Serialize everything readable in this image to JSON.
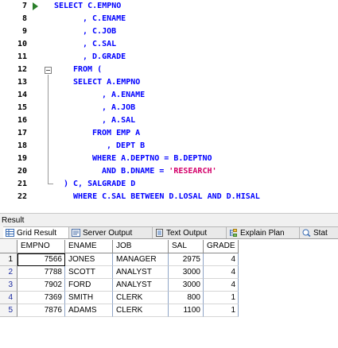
{
  "editor": {
    "lines": [
      {
        "num": "7",
        "indent": 0,
        "code": "SELECT C.EMPNO"
      },
      {
        "num": "8",
        "indent": 6,
        "code": ", C.ENAME"
      },
      {
        "num": "9",
        "indent": 6,
        "code": ", C.JOB"
      },
      {
        "num": "10",
        "indent": 6,
        "code": ", C.SAL"
      },
      {
        "num": "11",
        "indent": 6,
        "code": ", D.GRADE"
      },
      {
        "num": "12",
        "indent": 4,
        "code": "FROM ("
      },
      {
        "num": "13",
        "indent": 4,
        "code": "SELECT A.EMPNO"
      },
      {
        "num": "14",
        "indent": 10,
        "code": ", A.ENAME"
      },
      {
        "num": "15",
        "indent": 10,
        "code": ", A.JOB"
      },
      {
        "num": "16",
        "indent": 10,
        "code": ", A.SAL"
      },
      {
        "num": "17",
        "indent": 8,
        "code": "FROM EMP A"
      },
      {
        "num": "18",
        "indent": 11,
        "code": ", DEPT B"
      },
      {
        "num": "19",
        "indent": 8,
        "code": "WHERE A.DEPTNO = B.DEPTNO"
      },
      {
        "num": "20",
        "indent": 10,
        "code": "AND B.DNAME = ",
        "string": "'RESEARCH'"
      },
      {
        "num": "21",
        "indent": 2,
        "code": ") C, SALGRADE D"
      },
      {
        "num": "22",
        "indent": 4,
        "code": "WHERE C.SAL BETWEEN D.LOSAL AND D.HISAL"
      }
    ]
  },
  "result": {
    "title": "Result",
    "tabs": [
      {
        "label": "Grid Result",
        "icon": "grid-icon"
      },
      {
        "label": "Server Output",
        "icon": "server-output-icon"
      },
      {
        "label": "Text Output",
        "icon": "text-output-icon"
      },
      {
        "label": "Explain Plan",
        "icon": "explain-plan-icon"
      },
      {
        "label": "Stat",
        "icon": "statistics-icon"
      }
    ],
    "columns": [
      "EMPNO",
      "ENAME",
      "JOB",
      "SAL",
      "GRADE"
    ],
    "rows": [
      {
        "n": "1",
        "cells": [
          "7566",
          "JONES",
          "MANAGER",
          "2975",
          "4"
        ]
      },
      {
        "n": "2",
        "cells": [
          "7788",
          "SCOTT",
          "ANALYST",
          "3000",
          "4"
        ]
      },
      {
        "n": "3",
        "cells": [
          "7902",
          "FORD",
          "ANALYST",
          "3000",
          "4"
        ]
      },
      {
        "n": "4",
        "cells": [
          "7369",
          "SMITH",
          "CLERK",
          "800",
          "1"
        ]
      },
      {
        "n": "5",
        "cells": [
          "7876",
          "ADAMS",
          "CLERK",
          "1100",
          "1"
        ]
      }
    ]
  },
  "colors": {
    "keyword": "#0000ff",
    "string": "#d4006a",
    "current_line_arrow": "#2a7f2a"
  }
}
